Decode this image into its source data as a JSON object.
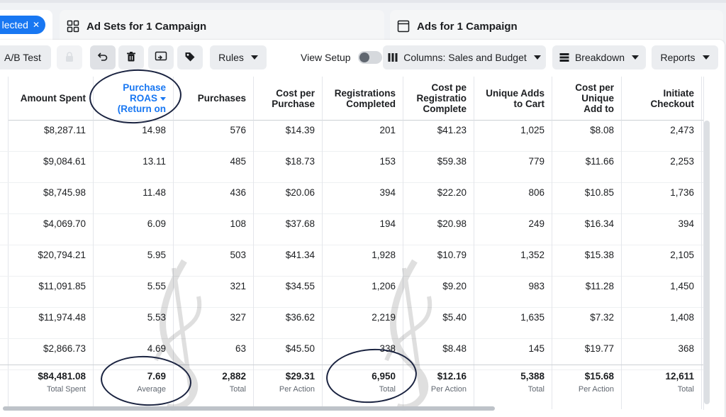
{
  "tabs": {
    "campaigns": {
      "selected_label": "lected",
      "close": "✕"
    },
    "adsets": {
      "title": "Ad Sets for 1 Campaign"
    },
    "ads": {
      "title": "Ads for 1 Campaign"
    }
  },
  "toolbar": {
    "ab_test": "A/B Test",
    "rules": "Rules",
    "view_setup": "View Setup",
    "columns": "Columns: Sales and Budget",
    "breakdown": "Breakdown",
    "reports": "Reports"
  },
  "table": {
    "columns": [
      {
        "key": "amount_spent",
        "label": "Amount Spent"
      },
      {
        "key": "roas",
        "label": "Purchase ROAS (Return on"
      },
      {
        "key": "purchases",
        "label": "Purchases"
      },
      {
        "key": "cost_per_purchase",
        "label": "Cost per Purchase"
      },
      {
        "key": "registrations",
        "label": "Registrations Completed"
      },
      {
        "key": "cost_per_registration",
        "label": "Cost per Registration Completed"
      },
      {
        "key": "unique_adds",
        "label": "Unique Adds to Cart"
      },
      {
        "key": "cost_per_unique_add",
        "label": "Cost per Unique Add to"
      },
      {
        "key": "initiate_checkout",
        "label": "Initiate Checkout"
      }
    ],
    "rows": [
      [
        "$8,287.11",
        "14.98",
        "576",
        "$14.39",
        "201",
        "$41.23",
        "1,025",
        "$8.08",
        "2,473"
      ],
      [
        "$9,084.61",
        "13.11",
        "485",
        "$18.73",
        "153",
        "$59.38",
        "779",
        "$11.66",
        "2,253"
      ],
      [
        "$8,745.98",
        "11.48",
        "436",
        "$20.06",
        "394",
        "$22.20",
        "806",
        "$10.85",
        "1,736"
      ],
      [
        "$4,069.70",
        "6.09",
        "108",
        "$37.68",
        "194",
        "$20.98",
        "249",
        "$16.34",
        "394"
      ],
      [
        "$20,794.21",
        "5.95",
        "503",
        "$41.34",
        "1,928",
        "$10.79",
        "1,352",
        "$15.38",
        "2,105"
      ],
      [
        "$11,091.85",
        "5.55",
        "321",
        "$34.55",
        "1,206",
        "$9.20",
        "983",
        "$11.28",
        "1,450"
      ],
      [
        "$11,974.48",
        "5.53",
        "327",
        "$36.62",
        "2,219",
        "$5.40",
        "1,635",
        "$7.32",
        "1,408"
      ],
      [
        "$2,866.73",
        "4.69",
        "63",
        "$45.50",
        "338",
        "$8.48",
        "145",
        "$19.77",
        "368"
      ]
    ],
    "totals": [
      {
        "value": "$84,481.08",
        "label": "Total Spent"
      },
      {
        "value": "7.69",
        "label": "Average"
      },
      {
        "value": "2,882",
        "label": "Total"
      },
      {
        "value": "$29.31",
        "label": "Per Action"
      },
      {
        "value": "6,950",
        "label": "Total"
      },
      {
        "value": "$12.16",
        "label": "Per Action"
      },
      {
        "value": "5,388",
        "label": "Total"
      },
      {
        "value": "$15.68",
        "label": "Per Action"
      },
      {
        "value": "12,611",
        "label": "Total"
      }
    ]
  },
  "colors": {
    "accent": "#1877f2",
    "annotation": "#1a2340"
  }
}
